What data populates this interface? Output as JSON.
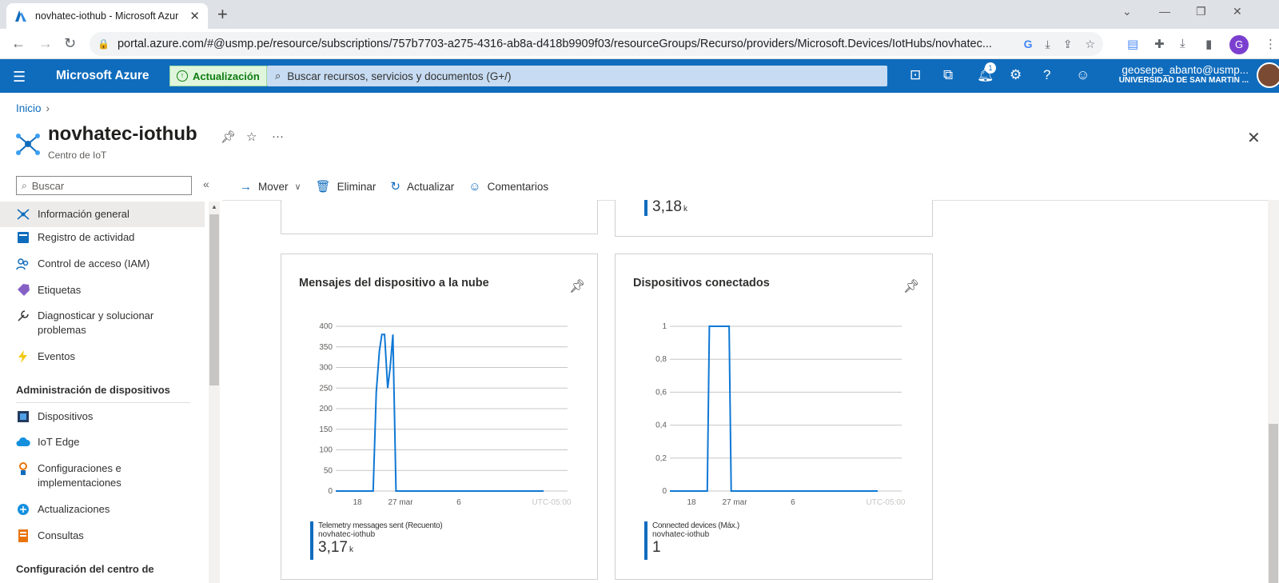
{
  "browser": {
    "tab_title": "novhatec-iothub - Microsoft Azur",
    "tab_close": "✕",
    "new_tab": "+",
    "url": "portal.azure.com/#@usmp.pe/resource/subscriptions/757b7703-a275-4316-ab8a-d418b9909f03/resourceGroups/Recurso/providers/Microsoft.Devices/IotHubs/novhatec...",
    "profile_initial": "G"
  },
  "azure": {
    "brand": "Microsoft Azure",
    "update_label": "Actualización",
    "search_placeholder": "Buscar recursos, servicios y documentos (G+/)",
    "notification_count": "1",
    "user_email": "geosepe_abanto@usmp...",
    "user_org": "UNIVERSIDAD DE SAN MARTIN ..."
  },
  "page": {
    "breadcrumb_home": "Inicio",
    "title": "novhatec-iothub",
    "subtitle": "Centro de IoT"
  },
  "nav": {
    "search_placeholder": "Buscar",
    "items": [
      {
        "label": "Información general"
      },
      {
        "label": "Registro de actividad"
      },
      {
        "label": "Control de acceso (IAM)"
      },
      {
        "label": "Etiquetas"
      },
      {
        "label": "Diagnosticar y solucionar problemas"
      },
      {
        "label": "Eventos"
      }
    ],
    "section1": "Administración de dispositivos",
    "items2": [
      {
        "label": "Dispositivos"
      },
      {
        "label": "IoT Edge"
      },
      {
        "label": "Configuraciones e implementaciones"
      },
      {
        "label": "Actualizaciones"
      },
      {
        "label": "Consultas"
      }
    ],
    "section2": "Configuración del centro de"
  },
  "toolbar": {
    "move": "Mover",
    "delete": "Eliminar",
    "refresh": "Actualizar",
    "feedback": "Comentarios"
  },
  "top_tile": {
    "value": "3,18",
    "unit": "k"
  },
  "tiles": {
    "messages": {
      "title": "Mensajes del dispositivo a la nube",
      "legend_metric": "Telemetry messages sent (Recuento)",
      "legend_resource": "novhatec-iothub",
      "legend_value": "3,17",
      "legend_unit": "k"
    },
    "devices": {
      "title": "Dispositivos conectados",
      "legend_metric": "Connected devices (Máx.)",
      "legend_resource": "novhatec-iothub",
      "legend_value": "1",
      "legend_unit": ""
    }
  },
  "chart_data": [
    {
      "type": "line",
      "title": "Mensajes del dispositivo a la nube",
      "x_ticks": [
        "18",
        "27 mar",
        "6",
        "UTC-05:00"
      ],
      "y_ticks": [
        "400",
        "350",
        "300",
        "250",
        "200",
        "150",
        "100",
        "50",
        "0"
      ],
      "ylim": [
        0,
        400
      ],
      "series": [
        {
          "name": "Telemetry messages sent (Recuento)",
          "color": "#0f78d4",
          "points": [
            [
              0,
              0
            ],
            [
              0.18,
              0
            ],
            [
              0.195,
              240
            ],
            [
              0.21,
              340
            ],
            [
              0.222,
              380
            ],
            [
              0.235,
              380
            ],
            [
              0.25,
              250
            ],
            [
              0.262,
              300
            ],
            [
              0.275,
              380
            ],
            [
              0.29,
              0
            ],
            [
              0.3,
              0
            ],
            [
              1,
              0
            ]
          ]
        }
      ]
    },
    {
      "type": "line",
      "title": "Dispositivos conectados",
      "x_ticks": [
        "18",
        "27 mar",
        "6",
        "UTC-05:00"
      ],
      "y_ticks": [
        "1",
        "0,8",
        "0,6",
        "0,4",
        "0,2",
        "0"
      ],
      "ylim": [
        0,
        1
      ],
      "series": [
        {
          "name": "Connected devices (Máx.)",
          "color": "#0f78d4",
          "points": [
            [
              0,
              0
            ],
            [
              0.18,
              0
            ],
            [
              0.19,
              1
            ],
            [
              0.285,
              1
            ],
            [
              0.295,
              0
            ],
            [
              1,
              0
            ]
          ]
        }
      ]
    }
  ]
}
